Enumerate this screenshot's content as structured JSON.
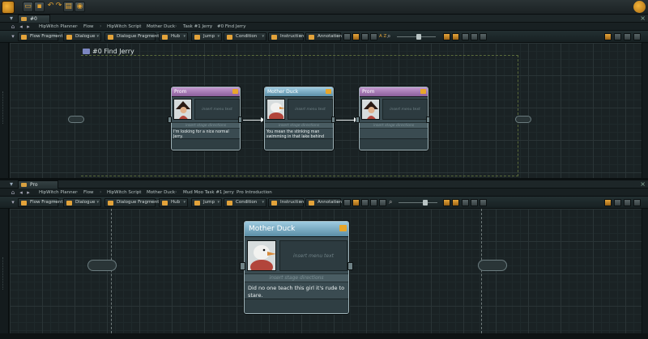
{
  "quick_access": [
    "open-icon",
    "save-icon",
    "undo-icon",
    "redo-icon",
    "window-icon",
    "settings-icon"
  ],
  "top": {
    "tab_title": "#0 Find Jerry",
    "breadcrumbs": [
      "HipWitch Planner",
      "Flow",
      "HipWitch Script",
      "Mother Duck",
      "Task #1 Jerry",
      "#0 Find Jerry"
    ],
    "toolbar": [
      "Flow Fragment",
      "Dialogue",
      "Dialogue Fragment",
      "Hub",
      "Jump",
      "Condition",
      "Instruction",
      "Annotation"
    ],
    "zoom_label": "A Z",
    "flow_title": "#0 Find Jerry",
    "nodes": [
      {
        "speaker": "Prom",
        "menu": "insert menu text",
        "stage": "insert stage directions",
        "text": "I'm looking for a nice normal Jerry."
      },
      {
        "speaker": "Mother Duck",
        "menu": "insert menu text",
        "stage": "insert stage directions",
        "text": "You mean the stinking man swimming in that lake behind you?"
      },
      {
        "speaker": "Prom",
        "menu": "insert menu text",
        "stage": "insert stage directions",
        "text": ""
      }
    ]
  },
  "bottom": {
    "tab_title": "Pro Introduction",
    "breadcrumbs": [
      "HipWitch Planner",
      "Flow",
      "HipWitch Script",
      "Mother Duck",
      "Mud Moo Task #1 Jerry",
      "Pro Introduction"
    ],
    "toolbar": [
      "Flow Fragment",
      "Dialogue",
      "Dialogue Fragment",
      "Hub",
      "Jump",
      "Condition",
      "Instruction",
      "Annotation"
    ],
    "node": {
      "speaker": "Mother Duck",
      "menu": "insert menu text",
      "stage": "insert stage directions",
      "text": "Did no one teach this girl it's rude to stare."
    }
  },
  "colors": {
    "accent": "#e3a33a",
    "grid": "#1a2224",
    "dialog_head_pink": "#a87ab6",
    "dialog_head_blue": "#7fb0c6"
  }
}
